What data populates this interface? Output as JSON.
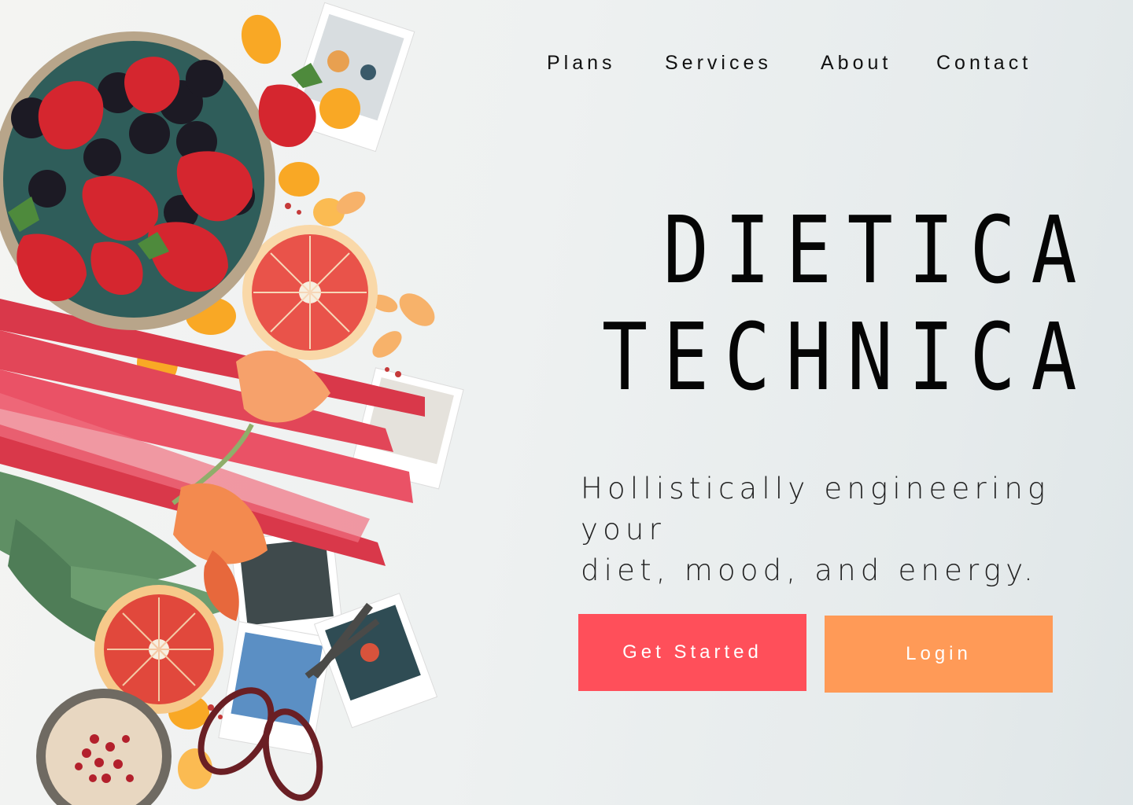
{
  "nav": {
    "items": [
      {
        "label": "Plans"
      },
      {
        "label": "Services"
      },
      {
        "label": "About"
      },
      {
        "label": "Contact"
      }
    ]
  },
  "hero": {
    "title_line_1": "DIETICA",
    "title_line_2": "TECHNICA",
    "tagline_line_1": "Hollistically engineering your",
    "tagline_line_2": "diet, mood, and energy."
  },
  "buttons": {
    "get_started_label": "Get Started",
    "login_label": "Login"
  },
  "colors": {
    "get_started_bg": "#ff4f5a",
    "login_bg": "#ff9a57",
    "title_text": "#050505",
    "page_bg": "#eef1f1"
  },
  "icons": [
    "fruit-flatlay-photo"
  ]
}
